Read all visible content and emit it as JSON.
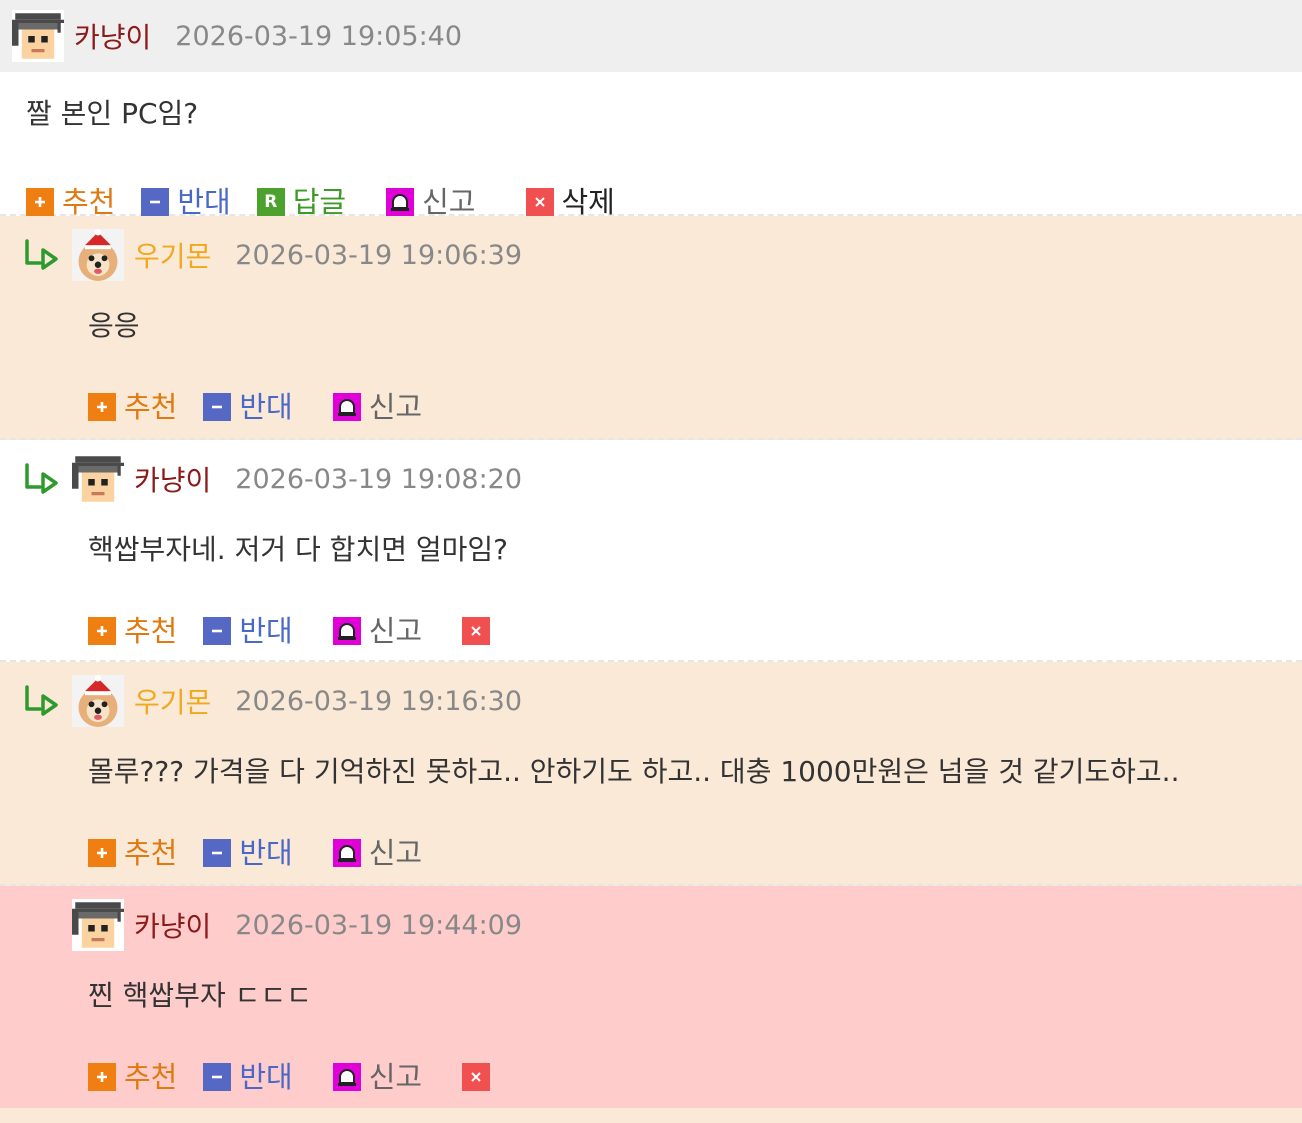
{
  "actions": {
    "recommend": "추천",
    "oppose": "반대",
    "reply": "답글",
    "report": "신고",
    "delete": "삭제"
  },
  "comments": [
    {
      "nickname": "카냥이",
      "timestamp": "2026-03-19 19:05:40",
      "text": "짤 본인 PC임?",
      "avatar": "pixel-boy-avatar"
    },
    {
      "nickname": "우기몬",
      "timestamp": "2026-03-19 19:06:39",
      "text": "응응",
      "avatar": "pomeranian-santa-avatar"
    },
    {
      "nickname": "카냥이",
      "timestamp": "2026-03-19 19:08:20",
      "text": "핵쌉부자네. 저거 다 합치면 얼마임?",
      "avatar": "pixel-boy-avatar"
    },
    {
      "nickname": "우기몬",
      "timestamp": "2026-03-19 19:16:30",
      "text": "몰루??? 가격을 다 기억하진 못하고.. 안하기도 하고.. 대충 1000만원은 넘을 것 같기도하고..",
      "avatar": "pomeranian-santa-avatar"
    },
    {
      "nickname": "카냥이",
      "timestamp": "2026-03-19 19:44:09",
      "text": "찐 핵쌉부자 ㄷㄷㄷ",
      "avatar": "pixel-boy-avatar"
    }
  ],
  "colors": {
    "peach_bg": "#fbe9d8",
    "pink_bg": "#ffcccc",
    "header_bg": "#efefef",
    "nick_dark_red": "#8b1a1a",
    "nick_gold": "#f0a81c"
  }
}
